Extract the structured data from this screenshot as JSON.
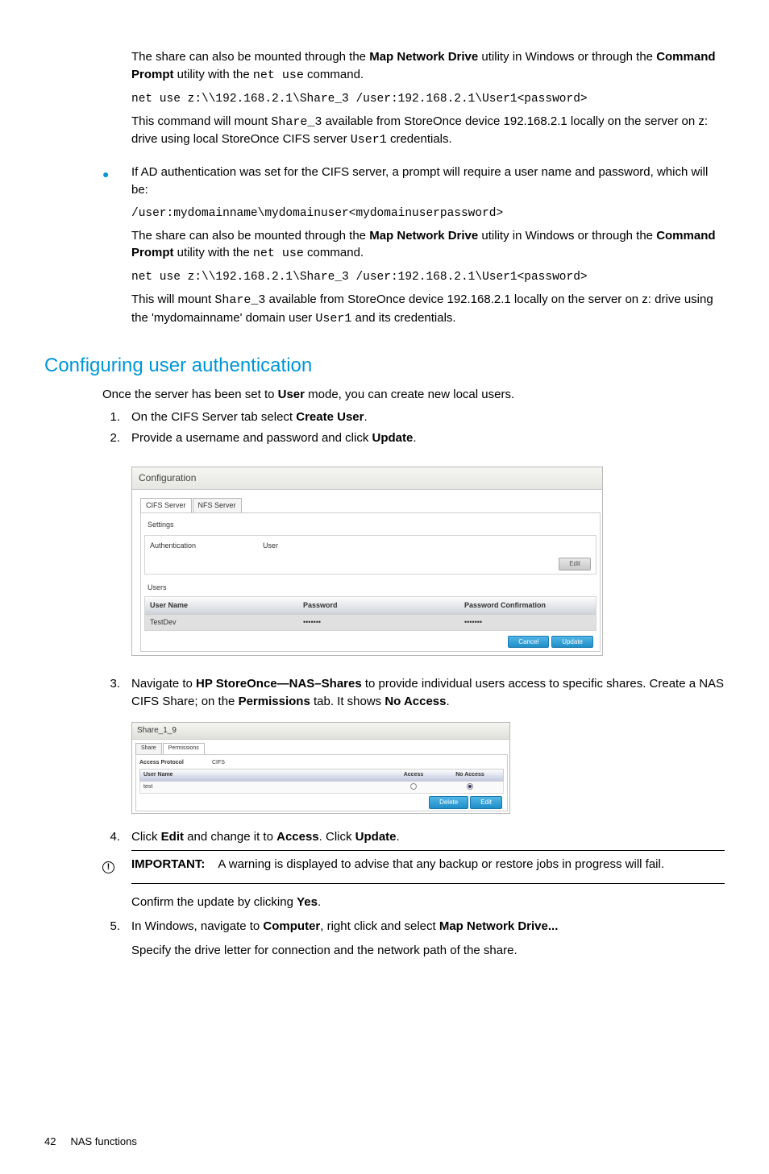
{
  "top": {
    "p1_a": "The share can also be mounted through the ",
    "p1_b": "Map Network Drive",
    "p1_c": " utility in Windows or through the ",
    "p1_d": "Command Prompt",
    "p1_e": " utility with the ",
    "p1_f": "net use",
    "p1_g": " command.",
    "code1": "net use z:\\\\192.168.2.1\\Share_3 /user:192.168.2.1\\User1<password>",
    "p2_a": "This command will mount ",
    "p2_b": "Share_3",
    "p2_c": " available from StoreOnce device 192.168.2.1 locally on the server on z: drive using local StoreOnce CIFS server ",
    "p2_d": "User1",
    "p2_e": " credentials."
  },
  "bullet": {
    "p1": "If AD authentication was set for the CIFS server, a prompt will require a user name and password, which will be:",
    "code1": "/user:mydomainname\\mydomainuser<mydomainuserpassword>",
    "p2_a": "The share can also be mounted through the ",
    "p2_b": "Map Network Drive",
    "p2_c": " utility in Windows or through the ",
    "p2_d": "Command Prompt",
    "p2_e": " utility with the ",
    "p2_f": "net use",
    "p2_g": " command.",
    "code2": "net use z:\\\\192.168.2.1\\Share_3 /user:192.168.2.1\\User1<password>",
    "p3_a": "This will mount ",
    "p3_b": "Share_3",
    "p3_c": " available from StoreOnce device 192.168.2.1 locally on the server on z: drive using the 'mydomainname' domain user ",
    "p3_d": "User1",
    "p3_e": " and its credentials."
  },
  "heading": "Configuring user authentication",
  "intro_a": "Once the server has been set to ",
  "intro_b": "User",
  "intro_c": " mode, you can create new local users.",
  "steps": {
    "n1": "1.",
    "s1_a": "On the CIFS Server tab select ",
    "s1_b": "Create User",
    "s1_c": ".",
    "n2": "2.",
    "s2_a": "Provide a username and password and click ",
    "s2_b": "Update",
    "s2_c": ".",
    "n3": "3.",
    "s3_a": "Navigate to ",
    "s3_b": "HP StoreOnce—NAS–Shares",
    "s3_c": " to provide individual users access to specific shares. Create a NAS CIFS Share; on the ",
    "s3_d": "Permissions",
    "s3_e": " tab. It shows ",
    "s3_f": "No Access",
    "s3_g": ".",
    "n4": "4.",
    "s4_a": "Click ",
    "s4_b": "Edit",
    "s4_c": " and change it to ",
    "s4_d": "Access",
    "s4_e": ". Click ",
    "s4_f": "Update",
    "s4_g": ".",
    "n5": "5.",
    "s5_a": "In Windows, navigate to ",
    "s5_b": "Computer",
    "s5_c": ", right click and select ",
    "s5_d": "Map Network Drive...",
    "s5_e": "Specify the drive letter for connection and the network path of the share."
  },
  "important": {
    "label": "IMPORTANT:",
    "text": "A warning is displayed to advise that any backup or restore jobs in progress will fail.",
    "confirm_a": "Confirm the update by clicking ",
    "confirm_b": "Yes",
    "confirm_c": "."
  },
  "shot1": {
    "title": "Configuration",
    "tab_cifs": "CIFS Server",
    "tab_nfs": "NFS Server",
    "settings": "Settings",
    "auth_label": "Authentication",
    "auth_val": "User",
    "edit": "Edit",
    "users": "Users",
    "col_user": "User Name",
    "col_pass": "Password",
    "col_conf": "Password Confirmation",
    "row_user": "TestDev",
    "row_pass": "•••••••",
    "row_conf": "•••••••",
    "cancel": "Cancel",
    "update": "Update"
  },
  "shot2": {
    "title": "Share_1_9",
    "tab_share": "Share",
    "tab_perm": "Permissions",
    "ap_label": "Access Protocol",
    "ap_val": "CIFS",
    "col_user": "User Name",
    "col_access": "Access",
    "col_noaccess": "No Access",
    "row_user": "test",
    "delete": "Delete",
    "edit": "Edit"
  },
  "footer": {
    "page": "42",
    "chapter": "NAS functions"
  }
}
